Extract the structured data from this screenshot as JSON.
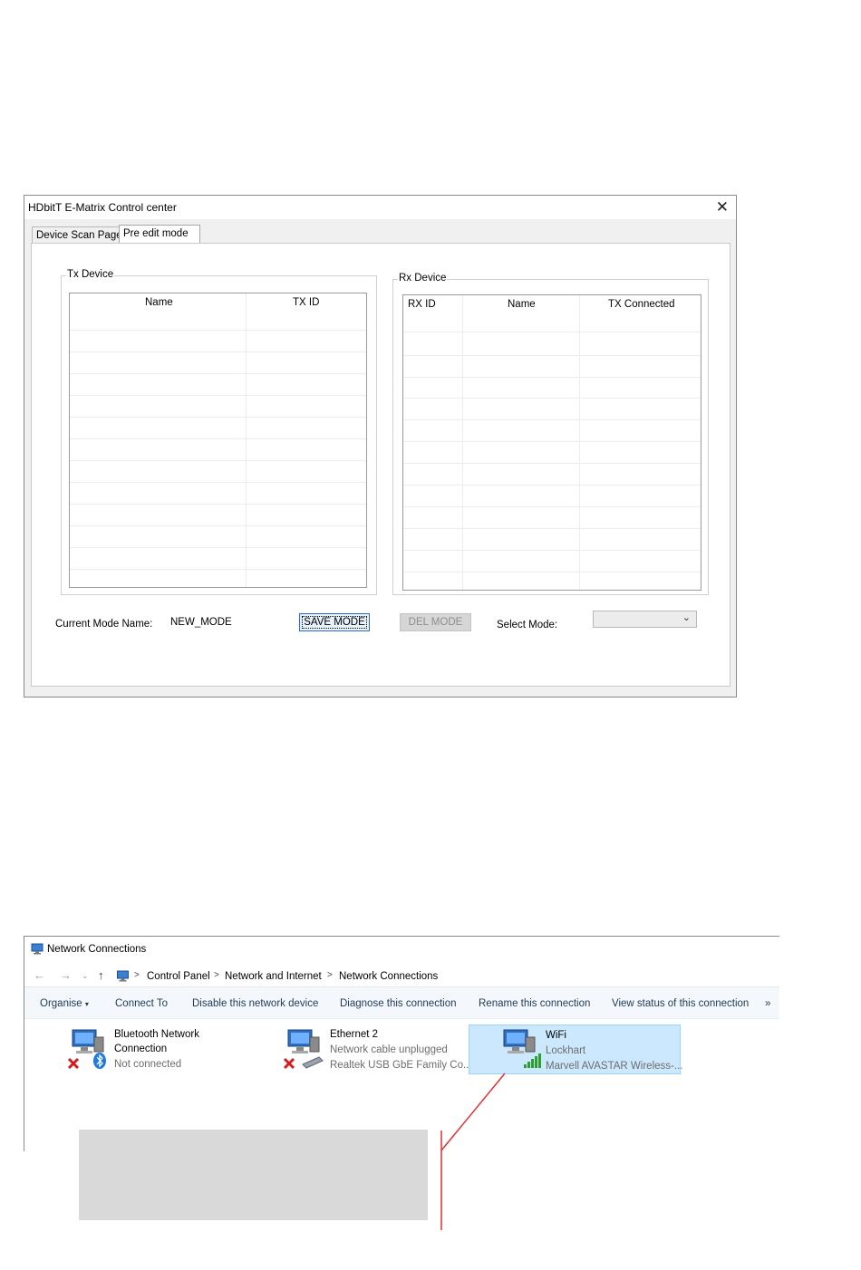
{
  "hdbitt": {
    "title": "HDbitT E-Matrix Control center",
    "tabs": [
      "Device Scan Page",
      "Pre edit mode"
    ],
    "tx_group": {
      "label": "Tx Device",
      "columns": [
        "Name",
        "TX ID"
      ]
    },
    "rx_group": {
      "label": "Rx Device",
      "columns": [
        "RX ID",
        "Name",
        "TX Connected"
      ]
    },
    "current_mode_label": "Current Mode Name:",
    "current_mode_value": "NEW_MODE",
    "save_mode_label": "SAVE MODE",
    "del_mode_label": "DEL MODE",
    "select_mode_label": "Select Mode:",
    "select_mode_value": ""
  },
  "netconn": {
    "title": "Network Connections",
    "breadcrumb": [
      "Control Panel",
      "Network and Internet",
      "Network Connections"
    ],
    "toolbar": [
      "Organise",
      "Connect To",
      "Disable this network device",
      "Diagnose this connection",
      "Rename this connection",
      "View status of this connection",
      "»"
    ],
    "connections": [
      {
        "name_line1": "Bluetooth Network",
        "name_line2": "Connection",
        "status": "Not connected"
      },
      {
        "name": "Ethernet 2",
        "status": "Network cable unplugged",
        "adapter": "Realtek USB GbE Family Co..."
      },
      {
        "name": "WiFi",
        "status": "Lockhart",
        "adapter": "Marvell AVASTAR Wireless-..."
      }
    ]
  },
  "colors": {
    "selection": "#cce8ff",
    "annotation_line": "#e03030",
    "annotation_box": "#d9d9d9"
  }
}
